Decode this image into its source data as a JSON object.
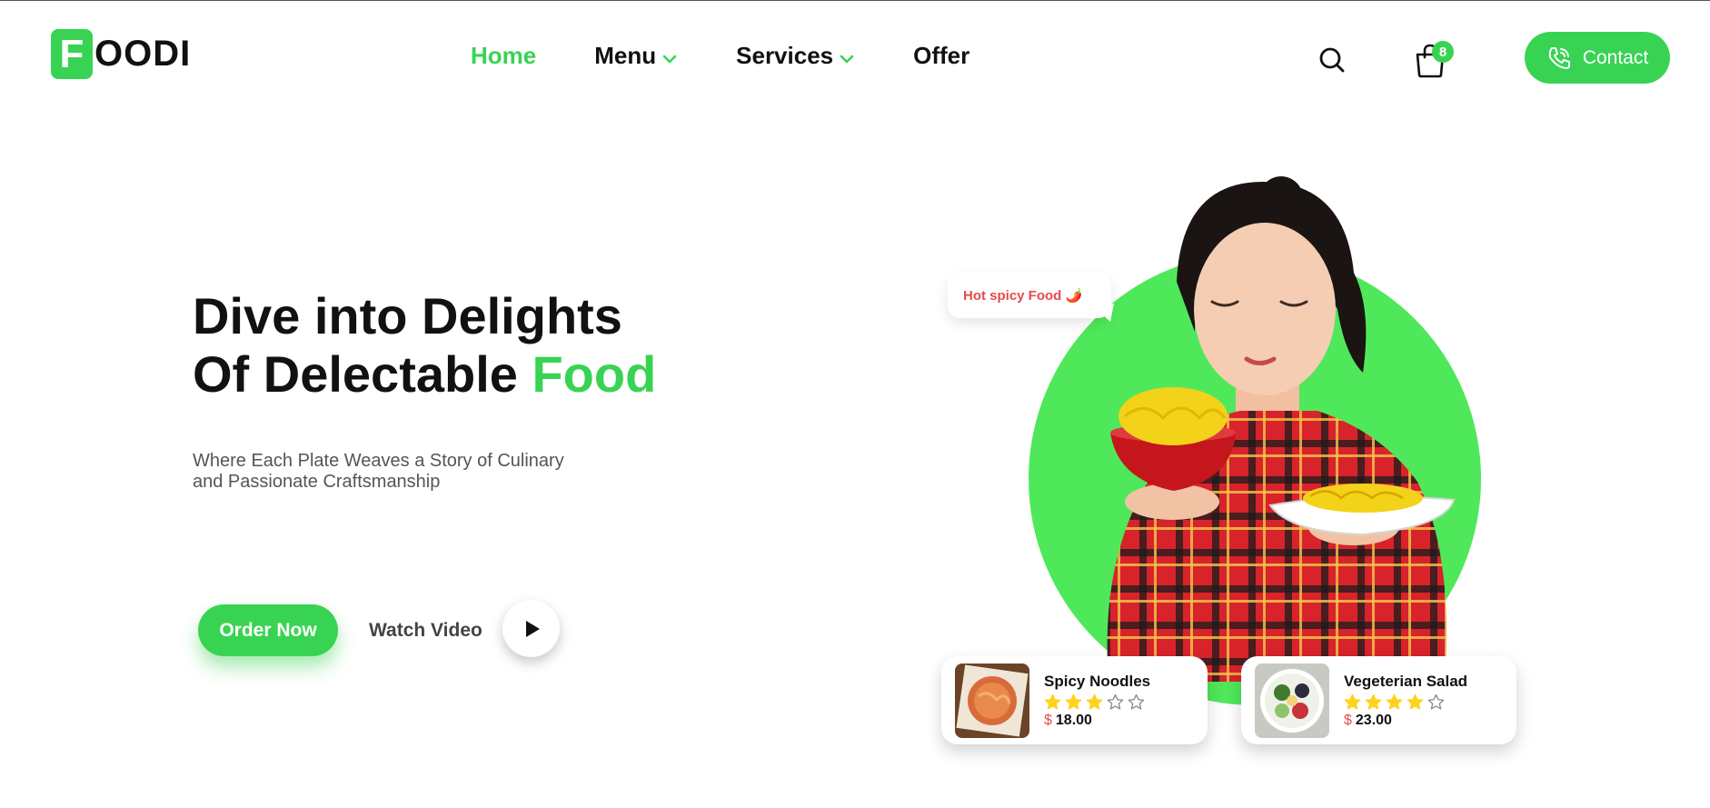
{
  "brand": {
    "logo_letter": "F",
    "logo_rest": "OODI"
  },
  "nav": {
    "home": "Home",
    "menu": "Menu",
    "services": "Services",
    "offer": "Offer"
  },
  "header": {
    "cart_count": "8",
    "contact_label": "Contact"
  },
  "hero": {
    "title_line1": "Dive into Delights",
    "title_line2_prefix": "Of Delectable",
    "title_accent": "Food",
    "subtitle_line1": "Where Each Plate Weaves a Story of Culinary",
    "subtitle_line2": "and Passionate Craftsmanship",
    "order_button": "Order Now",
    "watch_label": "Watch Video",
    "bubble_text": "Hot spicy Food 🌶️"
  },
  "cards": [
    {
      "name": "Spicy Noodles",
      "rating": 3,
      "max_rating": 5,
      "currency": "$",
      "price": "18.00"
    },
    {
      "name": "Vegeterian Salad",
      "rating": 4,
      "max_rating": 5,
      "currency": "$",
      "price": "23.00"
    }
  ],
  "colors": {
    "accent": "#39d353",
    "circle": "#4fe85a",
    "price_symbol": "#e64b4b",
    "star": "#ffd21f"
  }
}
